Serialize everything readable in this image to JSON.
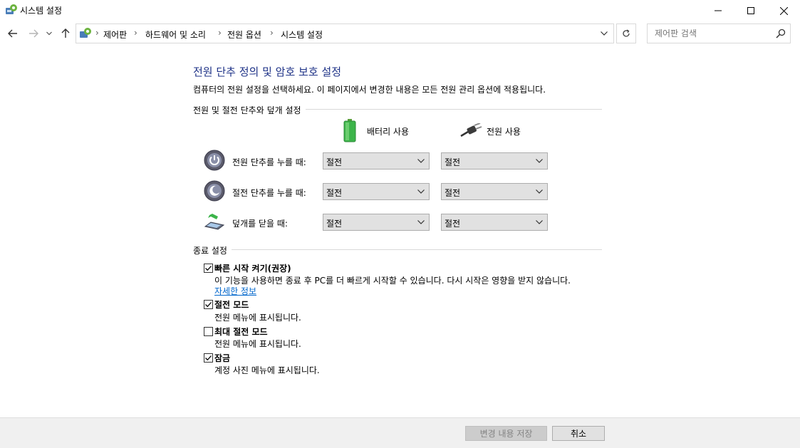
{
  "window": {
    "title": "시스템 설정"
  },
  "breadcrumbs": [
    "제어판",
    "하드웨어 및 소리",
    "전원 옵션",
    "시스템 설정"
  ],
  "search": {
    "placeholder": "제어판 검색"
  },
  "page": {
    "title": "전원 단추 정의 및 암호 보호 설정",
    "description": "컴퓨터의 전원 설정을 선택하세요. 이 페이지에서 변경한 내용은 모든 전원 관리 옵션에 적용됩니다."
  },
  "power_section": {
    "heading": "전원 및 절전 단추와 덮개 설정",
    "columns": {
      "battery": "배터리 사용",
      "plugged": "전원 사용"
    },
    "rows": [
      {
        "label": "전원 단추를 누를 때:",
        "battery": "절전",
        "plugged": "절전",
        "icon": "power-button-icon"
      },
      {
        "label": "절전 단추를 누를 때:",
        "battery": "절전",
        "plugged": "절전",
        "icon": "sleep-button-icon"
      },
      {
        "label": "덮개를 닫을 때:",
        "battery": "절전",
        "plugged": "절전",
        "icon": "laptop-lid-icon"
      }
    ]
  },
  "shutdown_section": {
    "heading": "종료 설정",
    "options": [
      {
        "title": "빠른 시작 켜기(권장)",
        "desc": "이 기능을 사용하면 종료 후 PC를 더 빠르게 시작할 수 있습니다. 다시 시작은 영향을 받지 않습니다.",
        "link": "자세한 정보",
        "checked": true
      },
      {
        "title": "절전 모드",
        "desc": "전원 메뉴에 표시됩니다.",
        "checked": true
      },
      {
        "title": "최대 절전 모드",
        "desc": "전원 메뉴에 표시됩니다.",
        "checked": false
      },
      {
        "title": "잠금",
        "desc": "계정 사진 메뉴에 표시됩니다.",
        "checked": true
      }
    ]
  },
  "footer": {
    "save_label": "변경 내용 저장",
    "cancel_label": "취소"
  },
  "colors": {
    "title_blue": "#1e3287",
    "link_blue": "#0066cc",
    "battery_green": "#3cb44a"
  }
}
